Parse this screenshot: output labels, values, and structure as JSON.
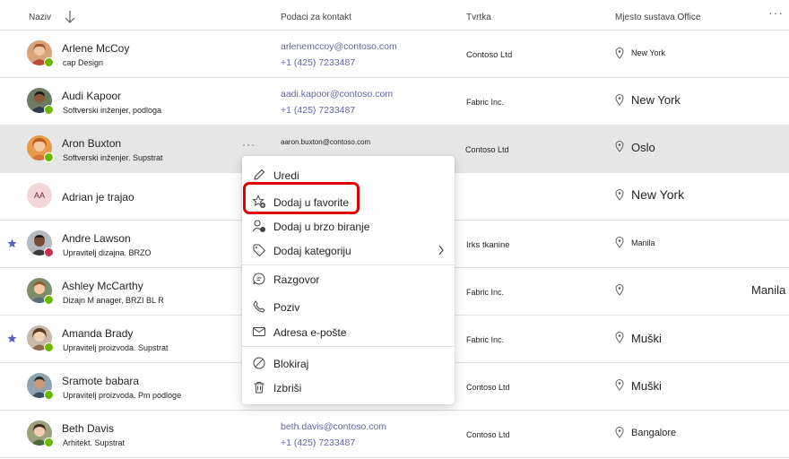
{
  "header": {
    "col_name": "Naziv",
    "col_contact": "Podaci za kontakt",
    "col_company": "Tvrtka",
    "col_location": "Mjesto sustava Office"
  },
  "rows": [
    {
      "name": "Arlene McCoy",
      "title": "cap Design",
      "email": "arlenemccoy@contoso.com",
      "phone": "+1 (425) 7233487",
      "company": "Contoso Ltd",
      "location": "New York"
    },
    {
      "name": "Audi Kapoor",
      "title": "Softverski inženjer, podloga",
      "email": "aadi.kapoor@contoso.com",
      "phone": "+1 (425) 7233487",
      "company": "Fabric Inc.",
      "location": "New York"
    },
    {
      "name": "Aron Buxton",
      "title": "Softverski inženjer. Supstrat",
      "email": "aaron.buxton@contoso.com",
      "phone": "",
      "company": "Contoso Ltd",
      "location": "Oslo"
    },
    {
      "name": "Adrian je trajao",
      "title": "",
      "initials": "AA",
      "email": "",
      "phone": "",
      "company": "",
      "location": "New York"
    },
    {
      "name": "Andre Lawson",
      "title": "Upravitelj dizajna. BRZO",
      "email": "",
      "phone": "",
      "company": "Irks tkanine",
      "location": "Manila"
    },
    {
      "name": "Ashley McCarthy",
      "title": "Dizajn M    anager,  BRZI BL R",
      "email": "",
      "phone": "",
      "company": "Fabric Inc.",
      "location": "",
      "extra": "Manila"
    },
    {
      "name": "Amanda Brady",
      "title": "Upravitelj proizvoda. Supstrat",
      "email": "",
      "phone": "",
      "company": "Fabric Inc.",
      "location": "Muški"
    },
    {
      "name": "Sramote babara",
      "title": "Upravitelj proizvoda. Pm podloge",
      "email": "",
      "phone": "",
      "company": "Contoso Ltd",
      "location": "Muški"
    },
    {
      "name": "Beth Davis",
      "title": "Arhitekt. Supstrat",
      "email": "beth.davis@contoso.com",
      "phone": "+1 (425) 7233487",
      "company": "Contoso Ltd",
      "location": "Bangalore"
    }
  ],
  "menu": {
    "edit": "Uredi",
    "add_favorite": "Dodaj u favorite",
    "add_speed_dial": "Dodaj u brzo biranje",
    "add_category": "Dodaj kategoriju",
    "chat": "Razgovor",
    "call": "Poziv",
    "email": "Adresa e-pošte",
    "block": "Blokiraj",
    "delete": "Izbriši"
  },
  "colors": {
    "accent": "#6264a7",
    "favorite_star": "#5b5fc7",
    "highlight_box": "#e00000",
    "available": "#6bb700",
    "busy": "#c4314b"
  },
  "icons": [
    "sort-down-icon",
    "more-icon",
    "location-pin-icon",
    "favorite-star-icon",
    "pencil-icon",
    "star-add-icon",
    "speed-dial-icon",
    "tag-icon",
    "chat-icon",
    "phone-icon",
    "mail-icon",
    "block-icon",
    "trash-icon",
    "chevron-right-icon"
  ]
}
